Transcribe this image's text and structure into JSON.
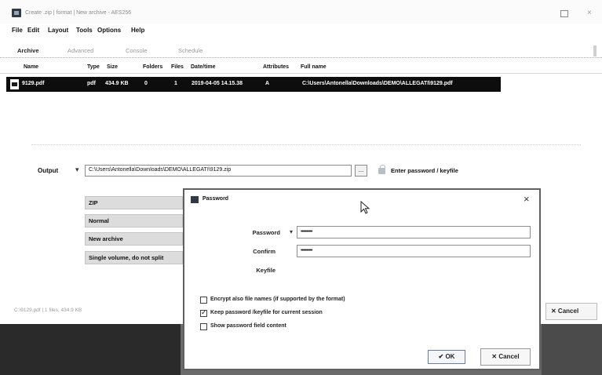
{
  "window": {
    "title": "Create .zip | format | New archive - AES256",
    "close_glyph": "×",
    "accent": "#0d0d0d"
  },
  "menu": [
    "File",
    "Edit",
    "Layout",
    "Tools",
    "Options",
    "Help"
  ],
  "tabs": [
    {
      "label": "Archive",
      "active": true
    },
    {
      "label": "Advanced",
      "active": false
    },
    {
      "label": "Console",
      "active": false
    },
    {
      "label": "Schedule",
      "active": false
    }
  ],
  "file_table": {
    "headers": [
      "Name",
      "Type",
      "Size",
      "Folders",
      "Files",
      "Date/time",
      "Attributes",
      "Full name"
    ],
    "rows": [
      {
        "name": "9129.pdf",
        "type": "pdf",
        "size": "434.9 KB",
        "folders": "0",
        "files": "1",
        "datetime": "2019-04-05 14.15.38",
        "attributes": "A",
        "fullname": "C:\\Users\\Antonella\\Downloads\\DEMO\\ALLEGATI\\9129.pdf"
      }
    ]
  },
  "output": {
    "label": "Output",
    "path": "C:\\Users\\Antonella\\Downloads\\DEMO\\ALLEGATI\\9129.zip",
    "browse_label": "...",
    "enter_password_label": "Enter password / keyfile"
  },
  "options": [
    "ZIP",
    "Normal",
    "New archive",
    "Single volume, do not split"
  ],
  "status_text": "C:\\9129.pdf | 1 files, 434.9 KB",
  "main_cancel_label": "✕ Cancel",
  "password_dialog": {
    "title": "Password",
    "close_glyph": "×",
    "password_label": "Password",
    "password_value": "••••••••••",
    "confirm_label": "Confirm",
    "confirm_value": "••••••••••",
    "keyfile_label": "Keyfile",
    "checkboxes": [
      {
        "label": "Encrypt also file names (if supported by the format)",
        "checked": false
      },
      {
        "label": "Keep password /keyfile for current session",
        "checked": true
      },
      {
        "label": "Show password field content",
        "checked": false
      }
    ],
    "ok_label": "✔ OK",
    "cancel_label": "✕ Cancel"
  }
}
